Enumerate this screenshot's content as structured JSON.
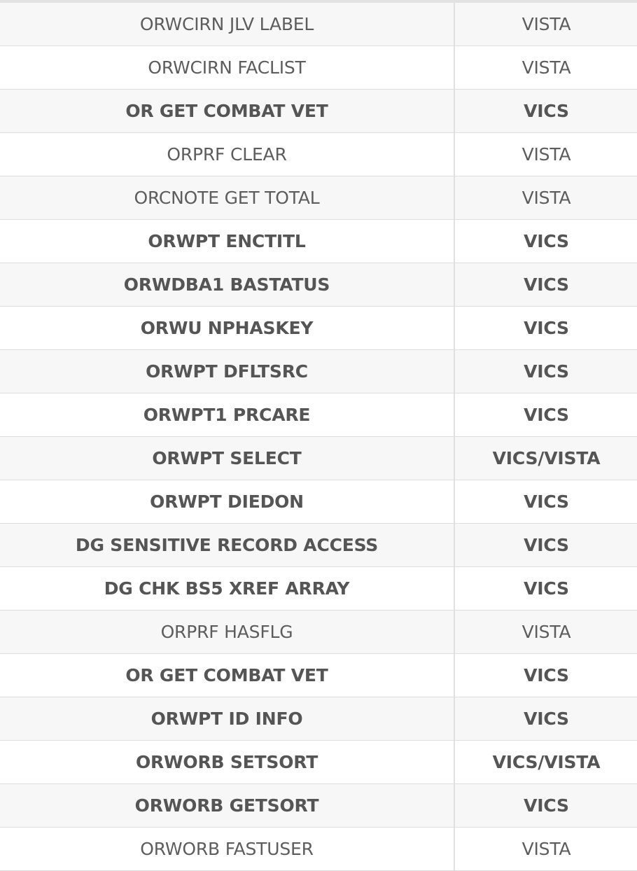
{
  "table": {
    "rows": [
      {
        "rpc": "ORWCIRN JLV LABEL",
        "source": "VISTA",
        "bold": false
      },
      {
        "rpc": "ORWCIRN FACLIST",
        "source": "VISTA",
        "bold": false
      },
      {
        "rpc": "OR GET COMBAT VET",
        "source": "VICS",
        "bold": true
      },
      {
        "rpc": "ORPRF CLEAR",
        "source": "VISTA",
        "bold": false
      },
      {
        "rpc": "ORCNOTE GET TOTAL",
        "source": "VISTA",
        "bold": false
      },
      {
        "rpc": "ORWPT ENCTITL",
        "source": "VICS",
        "bold": true
      },
      {
        "rpc": "ORWDBA1 BASTATUS",
        "source": "VICS",
        "bold": true
      },
      {
        "rpc": "ORWU NPHASKEY",
        "source": "VICS",
        "bold": true
      },
      {
        "rpc": "ORWPT DFLTSRC",
        "source": "VICS",
        "bold": true
      },
      {
        "rpc": "ORWPT1 PRCARE",
        "source": "VICS",
        "bold": true
      },
      {
        "rpc": "ORWPT SELECT",
        "source": "VICS/VISTA",
        "bold": true
      },
      {
        "rpc": "ORWPT DIEDON",
        "source": "VICS",
        "bold": true
      },
      {
        "rpc": "DG SENSITIVE RECORD ACCESS",
        "source": "VICS",
        "bold": true
      },
      {
        "rpc": "DG CHK BS5 XREF ARRAY",
        "source": "VICS",
        "bold": true
      },
      {
        "rpc": "ORPRF HASFLG",
        "source": "VISTA",
        "bold": false
      },
      {
        "rpc": "OR GET COMBAT VET",
        "source": "VICS",
        "bold": true
      },
      {
        "rpc": "ORWPT ID INFO",
        "source": "VICS",
        "bold": true
      },
      {
        "rpc": "ORWORB SETSORT",
        "source": "VICS/VISTA",
        "bold": true
      },
      {
        "rpc": "ORWORB GETSORT",
        "source": "VICS",
        "bold": true
      },
      {
        "rpc": "ORWORB FASTUSER",
        "source": "VISTA",
        "bold": false
      }
    ]
  }
}
